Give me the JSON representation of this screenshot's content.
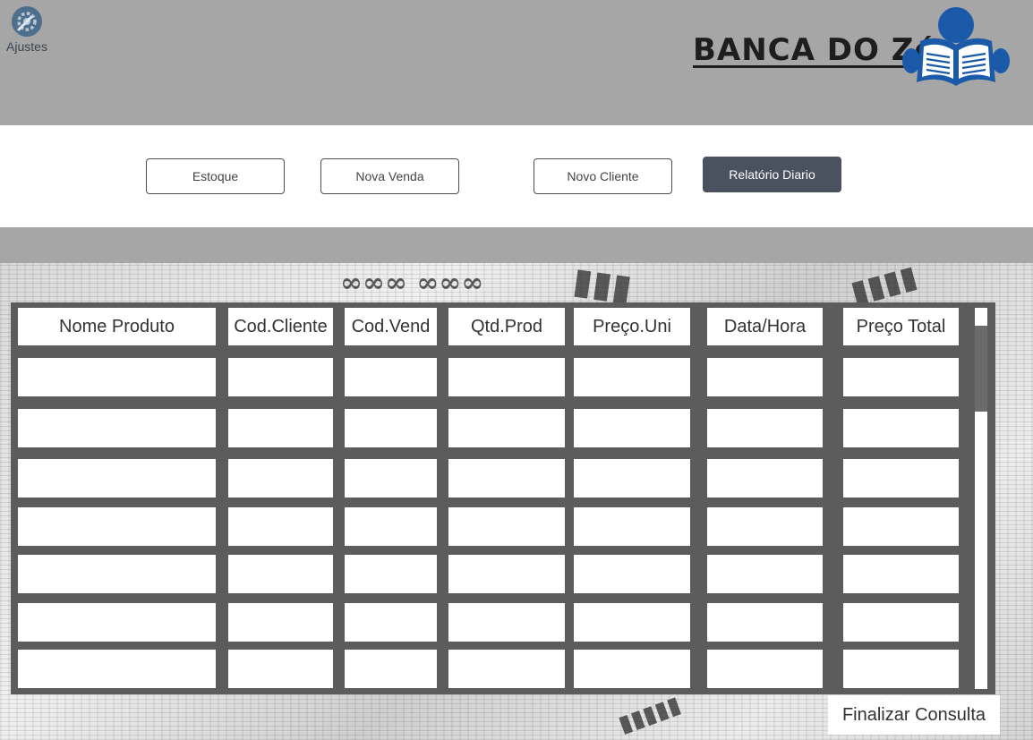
{
  "header": {
    "settings_label": "Ajustes",
    "brand": "BANCA DO Zé",
    "brand_color": "#1e1e1e",
    "logo_icon": "reading-person-icon",
    "logo_color": "#1a5aa8"
  },
  "nav": {
    "buttons": [
      {
        "label": "Estoque"
      },
      {
        "label": "Nova Venda"
      },
      {
        "label": "Novo Cliente"
      },
      {
        "label": "Relatório Diario",
        "active": true
      }
    ]
  },
  "table": {
    "columns": [
      "Nome Produto",
      "Cod.Cliente",
      "Cod.Vend",
      "Qtd.Prod",
      "Preço.Uni",
      "Data/Hora",
      "Preço Total"
    ],
    "rows": [
      [
        "",
        "",
        "",
        "",
        "",
        "",
        ""
      ],
      [
        "",
        "",
        "",
        "",
        "",
        "",
        ""
      ],
      [
        "",
        "",
        "",
        "",
        "",
        "",
        ""
      ],
      [
        "",
        "",
        "",
        "",
        "",
        "",
        ""
      ],
      [
        "",
        "",
        "",
        "",
        "",
        "",
        ""
      ],
      [
        "",
        "",
        "",
        "",
        "",
        "",
        ""
      ],
      [
        "",
        "",
        "",
        "",
        "",
        "",
        ""
      ]
    ]
  },
  "footer": {
    "finish_label": "Finalizar Consulta"
  },
  "colors": {
    "header_bg": "#a6a6a6",
    "active_button_bg": "#4a5260",
    "table_frame": "#5c5c5c"
  }
}
